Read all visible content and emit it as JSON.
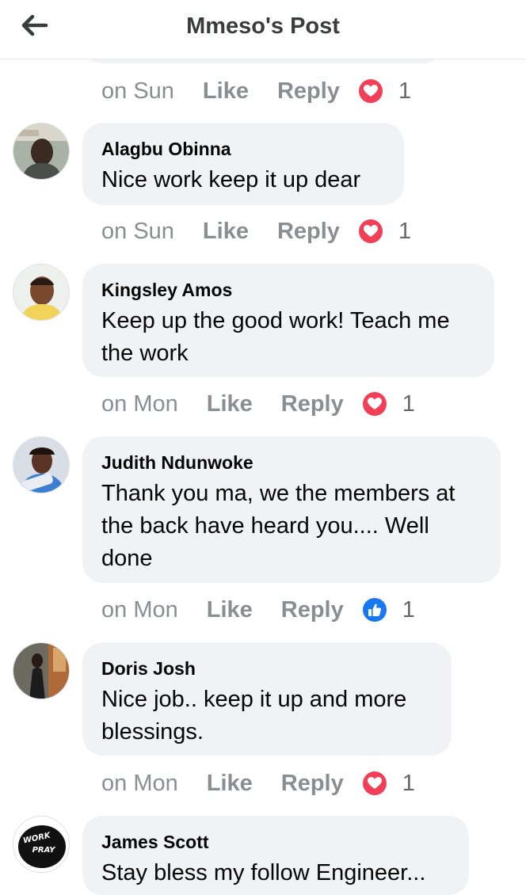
{
  "header": {
    "title": "Mmeso's Post"
  },
  "comments": [
    {
      "author": "",
      "text": "",
      "meta": {
        "time": "on Sun",
        "like": "Like",
        "reply": "Reply",
        "reaction": "love-icon",
        "count": "1"
      }
    },
    {
      "author": "Alagbu Obinna",
      "text": "Nice work keep it up dear",
      "meta": {
        "time": "on Sun",
        "like": "Like",
        "reply": "Reply",
        "reaction": "love-icon",
        "count": "1"
      }
    },
    {
      "author": "Kingsley Amos",
      "text": "Keep up the good work! Teach me the work",
      "meta": {
        "time": "on Mon",
        "like": "Like",
        "reply": "Reply",
        "reaction": "love-icon",
        "count": "1"
      }
    },
    {
      "author": "Judith Ndunwoke",
      "text": "Thank you ma, we the members at the back have heard you.... Well done",
      "meta": {
        "time": "on Mon",
        "like": "Like",
        "reply": "Reply",
        "reaction": "like-icon",
        "count": "1"
      }
    },
    {
      "author": "Doris Josh",
      "text": "Nice job.. keep it up and more blessings.",
      "meta": {
        "time": "on Mon",
        "like": "Like",
        "reply": "Reply",
        "reaction": "love-icon",
        "count": "1"
      }
    },
    {
      "author": "James Scott",
      "text": "Stay bless my follow Engineer..."
    }
  ],
  "avatars": {
    "james_scott_logo_line1": "WORK",
    "james_scott_logo_line2": "PRAY"
  },
  "colors": {
    "bubble": "#f0f2f5",
    "love": "#f33e58",
    "like": "#1877f2",
    "meta_text": "#8a8d91"
  }
}
